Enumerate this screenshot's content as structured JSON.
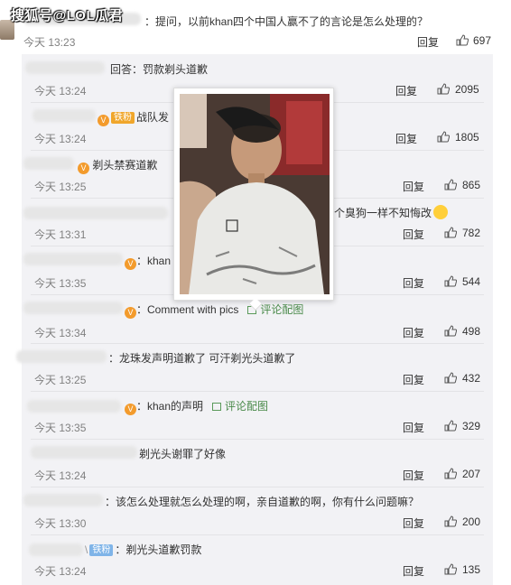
{
  "watermark": "搜狐号@LOL瓜君",
  "top_comment": {
    "text": "：提问，以前khan四个中国人赢不了的言论是怎么处理的？",
    "time": "今天 13:23",
    "reply_label": "回复",
    "likes": "697"
  },
  "replies": [
    {
      "text": "回答：罚款剃头道歉",
      "time": "今天 13:24",
      "reply_label": "回复",
      "likes": "2095"
    },
    {
      "text": "战队发",
      "badge": "铁粉",
      "time": "今天 13:24",
      "reply_label": "回复",
      "likes": "1805"
    },
    {
      "text": "剃头禁赛道歉",
      "time": "今天 13:25",
      "reply_label": "回复",
      "likes": "865"
    },
    {
      "text": "个臭狗一样不知悔改",
      "time": "今天 13:31",
      "reply_label": "回复",
      "likes": "782"
    },
    {
      "text": "：khan",
      "time": "今天 13:35",
      "reply_label": "回复",
      "likes": "544"
    },
    {
      "text": "：Comment with pics",
      "pic_label": "评论配图",
      "time": "今天 13:34",
      "reply_label": "回复",
      "likes": "498"
    },
    {
      "text": "：龙珠发声明道歉了 可汗剃光头道歉了",
      "time": "今天 13:25",
      "reply_label": "回复",
      "likes": "432"
    },
    {
      "text": "：khan的声明",
      "pic_label": "评论配图",
      "time": "今天 13:35",
      "reply_label": "回复",
      "likes": "329"
    },
    {
      "text": "剃光头谢罪了好像",
      "time": "今天 13:24",
      "reply_label": "回复",
      "likes": "207"
    },
    {
      "text": "：该怎么处理就怎么处理的啊，亲自道歉的啊，你有什么问题嘛？",
      "time": "今天 13:30",
      "reply_label": "回复",
      "likes": "200"
    },
    {
      "text": "：剃光头道歉罚款",
      "badge": "铁粉",
      "time": "今天 13:24",
      "reply_label": "回复",
      "likes": "135"
    }
  ],
  "colors": {
    "panel_bg": "#f2f2f5",
    "time": "#808080",
    "pic_link": "#4a8a4a",
    "badge_gold": "#f0a62b",
    "badge_blue": "#7fb4e8"
  }
}
